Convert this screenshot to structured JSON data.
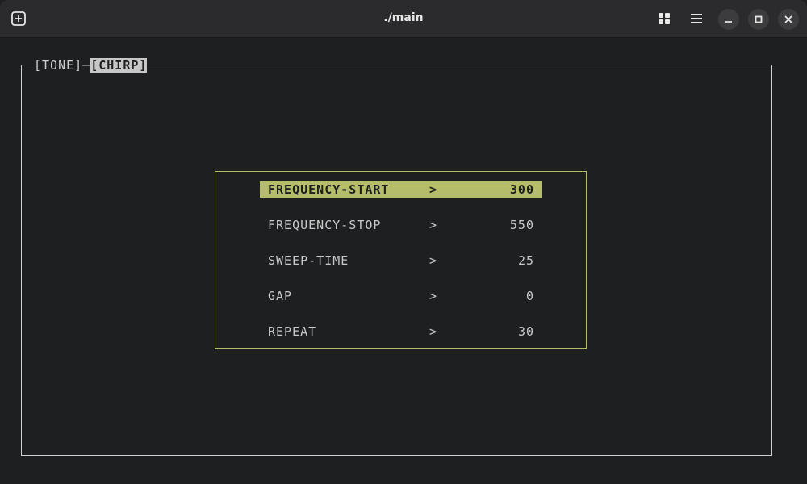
{
  "window": {
    "title": "./main"
  },
  "tabs": {
    "left_bracket_1": "[TONE]",
    "active": "[CHIRP]"
  },
  "menu": {
    "items": [
      {
        "label": "FREQUENCY-START",
        "arrow": ">",
        "value": "300"
      },
      {
        "label": "FREQUENCY-STOP",
        "arrow": ">",
        "value": "550"
      },
      {
        "label": "SWEEP-TIME",
        "arrow": ">",
        "value": "25"
      },
      {
        "label": "GAP",
        "arrow": ">",
        "value": "0"
      },
      {
        "label": "REPEAT",
        "arrow": ">",
        "value": "30"
      }
    ],
    "selected_index": 0
  },
  "colors": {
    "accent": "#b5bd6a",
    "background": "#1e1f21",
    "titlebar": "#2b2b2d",
    "text": "#c8c8c8"
  },
  "icons": {
    "new_tab": "new-tab-icon",
    "grid": "grid-view-icon",
    "menu": "hamburger-menu-icon",
    "minimize": "minimize-icon",
    "maximize": "maximize-icon",
    "close": "close-icon"
  }
}
